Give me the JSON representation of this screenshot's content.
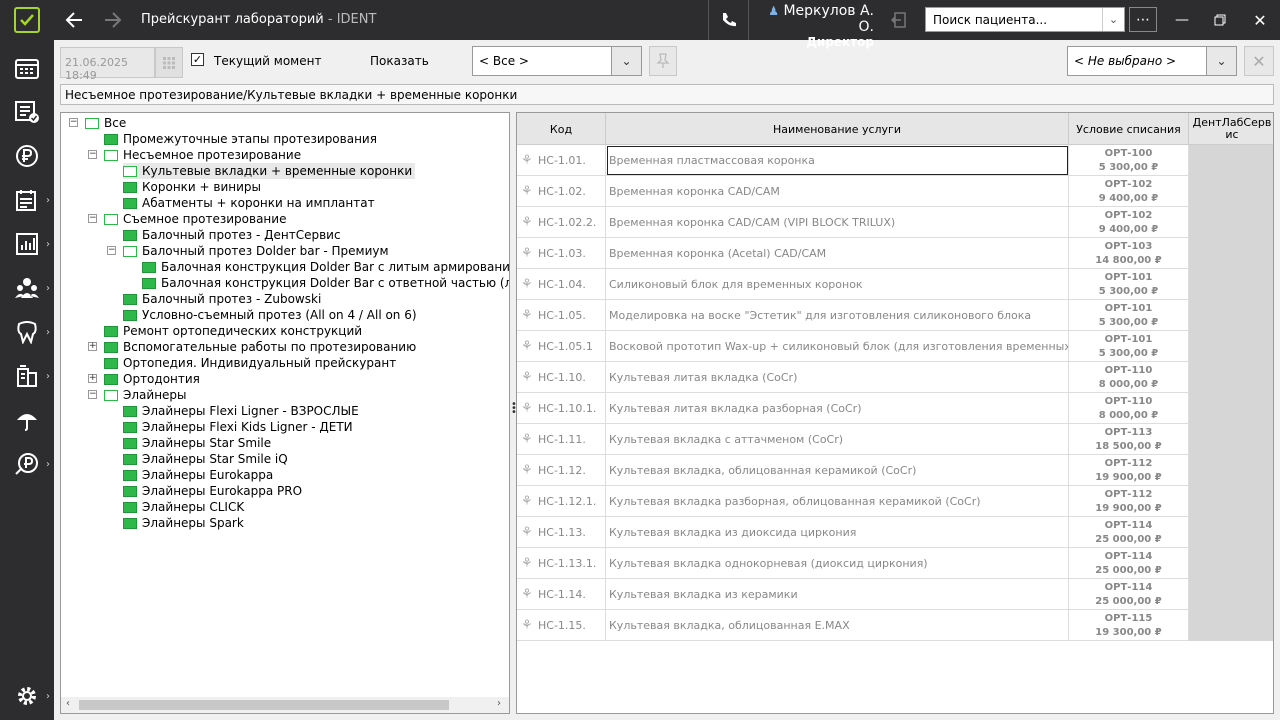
{
  "app": {
    "title": "Прейскурант лабораторий",
    "title_suffix": " - IDENT"
  },
  "user": {
    "name": "Меркулов А. О.",
    "role": "Директор"
  },
  "search": {
    "placeholder": "Поиск пациента..."
  },
  "toolbar": {
    "date": "21.06.2025 18:49",
    "current_moment_label": "Текущий момент",
    "current_moment_checked": true,
    "show_label": "Показать",
    "show_value": "< Все >",
    "lab_value": "< Не выбрано >"
  },
  "breadcrumb": "Несъемное протезирование/Культевые вкладки + временные коронки",
  "tree": [
    {
      "label": "Все",
      "level": 0,
      "expander": "minus",
      "icon": "open"
    },
    {
      "label": "Промежуточные этапы протезирования",
      "level": 1,
      "expander": "",
      "icon": "full"
    },
    {
      "label": "Несъемное протезирование",
      "level": 1,
      "expander": "minus",
      "icon": "open"
    },
    {
      "label": "Культевые вкладки + временные коронки",
      "level": 2,
      "expander": "",
      "icon": "open",
      "selected": true
    },
    {
      "label": "Коронки + виниры",
      "level": 2,
      "expander": "",
      "icon": "full"
    },
    {
      "label": "Абатменты + коронки на имплантат",
      "level": 2,
      "expander": "",
      "icon": "full"
    },
    {
      "label": "Съемное протезирование",
      "level": 1,
      "expander": "minus",
      "icon": "open"
    },
    {
      "label": "Балочный протез - ДентСервис",
      "level": 2,
      "expander": "",
      "icon": "full"
    },
    {
      "label": "Балочный протез Dolder bar - Премиум",
      "level": 2,
      "expander": "minus",
      "icon": "open"
    },
    {
      "label": "Балочная конструкция Dolder Bar с литым армированием",
      "level": 3,
      "expander": "",
      "icon": "full"
    },
    {
      "label": "Балочная конструкция Dolder Bar с ответной частью (лазерное спекание)",
      "level": 3,
      "expander": "",
      "icon": "full"
    },
    {
      "label": "Балочный протез - Zubowski",
      "level": 2,
      "expander": "",
      "icon": "full"
    },
    {
      "label": "Условно-съемный протез (All on 4 / All on 6)",
      "level": 2,
      "expander": "",
      "icon": "full"
    },
    {
      "label": "Ремонт ортопедических конструкций",
      "level": 1,
      "expander": "",
      "icon": "full"
    },
    {
      "label": "Вспомогательные работы по протезированию",
      "level": 1,
      "expander": "plus",
      "icon": "full"
    },
    {
      "label": "Ортопедия. Индивидуальный прейскурант",
      "level": 1,
      "expander": "",
      "icon": "full"
    },
    {
      "label": "Ортодонтия",
      "level": 1,
      "expander": "plus",
      "icon": "full"
    },
    {
      "label": "Элайнеры",
      "level": 1,
      "expander": "minus",
      "icon": "open"
    },
    {
      "label": "Элайнеры Flexi Ligner - ВЗРОСЛЫЕ",
      "level": 2,
      "expander": "",
      "icon": "full"
    },
    {
      "label": "Элайнеры Flexi Kids Ligner - ДЕТИ",
      "level": 2,
      "expander": "",
      "icon": "full"
    },
    {
      "label": "Элайнеры Star Smile",
      "level": 2,
      "expander": "",
      "icon": "full"
    },
    {
      "label": "Элайнеры Star Smile iQ",
      "level": 2,
      "expander": "",
      "icon": "full"
    },
    {
      "label": "Элайнеры Eurokappa",
      "level": 2,
      "expander": "",
      "icon": "full"
    },
    {
      "label": "Элайнеры Eurokappa PRO",
      "level": 2,
      "expander": "",
      "icon": "full"
    },
    {
      "label": "Элайнеры CLICK",
      "level": 2,
      "expander": "",
      "icon": "full"
    },
    {
      "label": "Элайнеры Spark",
      "level": 2,
      "expander": "",
      "icon": "full"
    }
  ],
  "grid": {
    "columns": [
      "Код",
      "Наименование услуги",
      "Условие списания",
      "ДентЛабСервис"
    ],
    "rows": [
      {
        "code": "НС-1.01.",
        "name": "Временная пластмассовая коронка",
        "cond_code": "ОРТ-100",
        "price": "5 300,00 ₽"
      },
      {
        "code": "НС-1.02.",
        "name": "Временная коронка CAD/CAM",
        "cond_code": "ОРТ-102",
        "price": "9 400,00 ₽"
      },
      {
        "code": "НС-1.02.2.",
        "name": "Временная коронка CAD/CAM (VIPI BLOCK TRILUX)",
        "cond_code": "ОРТ-102",
        "price": "9 400,00 ₽"
      },
      {
        "code": "НС-1.03.",
        "name": "Временная коронка (Acetal) CAD/CAM",
        "cond_code": "ОРТ-103",
        "price": "14 800,00 ₽"
      },
      {
        "code": "НС-1.04.",
        "name": "Силиконовый блок для временных коронок",
        "cond_code": "ОРТ-101",
        "price": "5 300,00 ₽"
      },
      {
        "code": "НС-1.05.",
        "name": "Моделировка на воске \"Эстетик\" для изготовления силиконового блока",
        "cond_code": "ОРТ-101",
        "price": "5 300,00 ₽"
      },
      {
        "code": "НС-1.05.1",
        "name": "Восковой прототип Wax-up + силиконовый блок (для изготовления временных коронок)",
        "cond_code": "ОРТ-101",
        "price": "5 300,00 ₽"
      },
      {
        "code": "НС-1.10.",
        "name": "Культевая литая вкладка (CoCr)",
        "cond_code": "ОРТ-110",
        "price": "8 000,00 ₽"
      },
      {
        "code": "НС-1.10.1.",
        "name": "Культевая литая вкладка разборная (CoCr)",
        "cond_code": "ОРТ-110",
        "price": "8 000,00 ₽"
      },
      {
        "code": "НС-1.11.",
        "name": "Культевая вкладка с аттачменом (CoCr)",
        "cond_code": "ОРТ-113",
        "price": "18 500,00 ₽"
      },
      {
        "code": "НС-1.12.",
        "name": "Культевая вкладка, облицованная керамикой (CoCr)",
        "cond_code": "ОРТ-112",
        "price": "19 900,00 ₽"
      },
      {
        "code": "НС-1.12.1.",
        "name": "Культевая вкладка разборная, облицованная керамикой (CoCr)",
        "cond_code": "ОРТ-112",
        "price": "19 900,00 ₽"
      },
      {
        "code": "НС-1.13.",
        "name": "Культевая вкладка из диоксида циркония",
        "cond_code": "ОРТ-114",
        "price": "25 000,00 ₽"
      },
      {
        "code": "НС-1.13.1.",
        "name": "Культевая вкладка однокорневая (диоксид циркония)",
        "cond_code": "ОРТ-114",
        "price": "25 000,00 ₽"
      },
      {
        "code": "НС-1.14.",
        "name": "Культевая вкладка из керамики",
        "cond_code": "ОРТ-114",
        "price": "25 000,00 ₽"
      },
      {
        "code": "НС-1.15.",
        "name": "Культевая вкладка, облицованная E.MAX",
        "cond_code": "ОРТ-115",
        "price": "19 300,00 ₽"
      }
    ]
  },
  "colors": {
    "accent": "#a3d52a",
    "folder": "#2fb84a",
    "bar": "#2d2d30"
  },
  "icons": {
    "logo": "check-logo-icon",
    "back": "arrow-left-icon",
    "forward": "arrow-right-icon",
    "phone": "phone-icon",
    "user": "user-icon",
    "logout": "logout-icon",
    "more": "more-icon",
    "settings": "gear-icon"
  }
}
